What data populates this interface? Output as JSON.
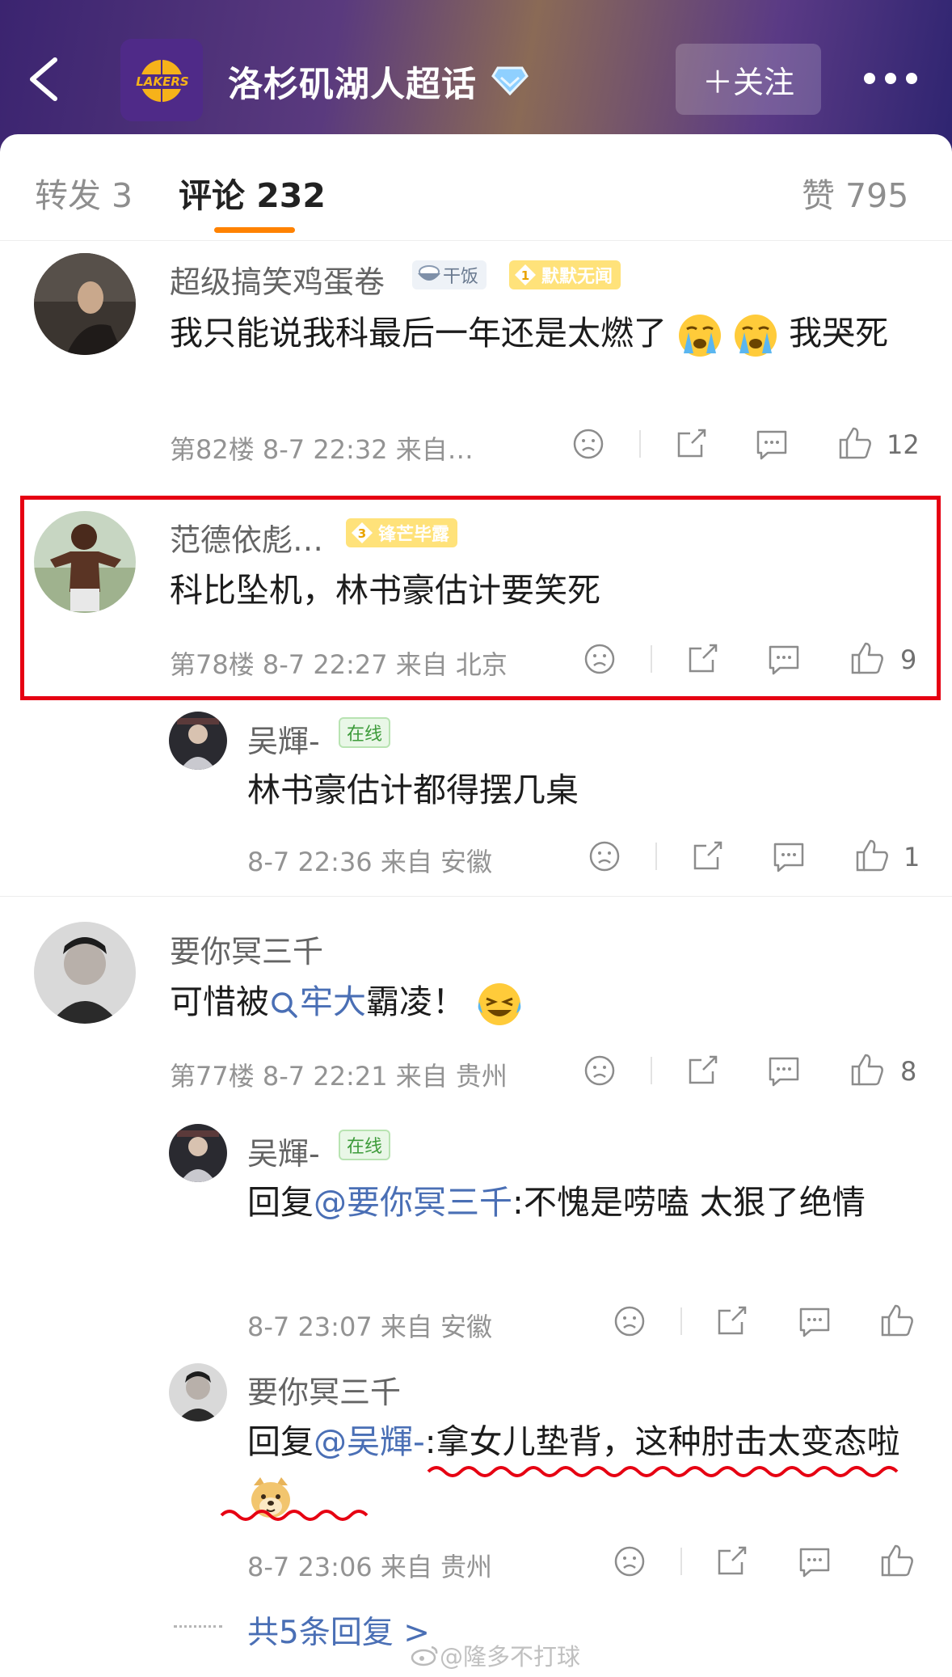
{
  "header": {
    "title": "洛杉矶湖人超话",
    "follow_label": "＋关注",
    "logo_text": "LAKERS"
  },
  "tabs": [
    {
      "label": "转发 3"
    },
    {
      "label": "评论 232"
    },
    {
      "label": "赞 795"
    }
  ],
  "comments": [
    {
      "user": "超级搞笑鸡蛋卷",
      "badge_rice": "干饭",
      "badge_level": "1",
      "badge_gold": "默默无闻",
      "text": "我只能说我科最后一年还是太燃了",
      "text_end": "我哭死",
      "meta": "第82楼  8-7 22:32  来自…",
      "likes": "12"
    },
    {
      "user": "范德依彪…",
      "badge_level": "3",
      "badge_gold": "锋芒毕露",
      "text": "科比坠机，林书豪估计要笑死",
      "meta": "第78楼  8-7 22:27  来自 北京",
      "likes": "9",
      "replies": [
        {
          "user": "吴輝-",
          "badge_online": "在线",
          "text": "林书豪估计都得摆几桌",
          "meta": "8-7 22:36  来自 安徽",
          "likes": "1"
        }
      ]
    },
    {
      "user": "要你冥三千",
      "text_before": "可惜被",
      "topic": "牢大",
      "text_after": "霸凌！",
      "meta": "第77楼  8-7 22:21  来自 贵州",
      "likes": "8",
      "replies": [
        {
          "user": "吴輝-",
          "badge_online": "在线",
          "reply_prefix": "回复",
          "mention": "@要你冥三千",
          "text": ":不愧是唠嗑 太狠了绝情",
          "meta": "8-7 23:07  来自 安徽"
        },
        {
          "user": "要你冥三千",
          "reply_prefix": "回复",
          "mention": "@吴輝-",
          "text": ":拿女儿垫背，这种肘击太变态啦",
          "meta": "8-7 23:06  来自 贵州"
        }
      ]
    }
  ],
  "more_replies": "共5条回复 >",
  "watermark": "@隆多不打球",
  "colors": {
    "accent": "#ff8200",
    "link": "#4a6fb5",
    "highlight": "#e60012"
  }
}
